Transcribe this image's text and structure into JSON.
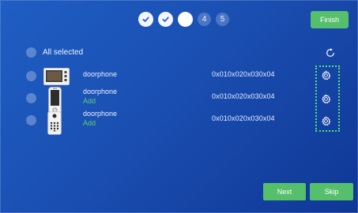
{
  "stepper": {
    "steps": [
      {
        "state": "done"
      },
      {
        "state": "done"
      },
      {
        "state": "current"
      },
      {
        "state": "next",
        "label": "4"
      },
      {
        "state": "next",
        "label": "5"
      }
    ]
  },
  "header": {
    "finish_label": "Finish"
  },
  "select_all": {
    "label": "All selected"
  },
  "devices": [
    {
      "image": "monitor-device-icon",
      "name": "doorphone",
      "action": "",
      "address": "0x010x020x030x04"
    },
    {
      "image": "handset-device-icon",
      "name": "doorphone",
      "action": "Add",
      "address": "0x010x020x030x04"
    },
    {
      "image": "outdoor-station-icon",
      "name": "doorphone",
      "action": "Add",
      "address": "0x010x020x030x04"
    }
  ],
  "footer": {
    "next_label": "Next",
    "skip_label": "Skip"
  },
  "colors": {
    "accent_green": "#55bf6c",
    "add_text": "#5fd06f",
    "background": "#1a4fb1",
    "highlight_border": "#4fe27a"
  }
}
